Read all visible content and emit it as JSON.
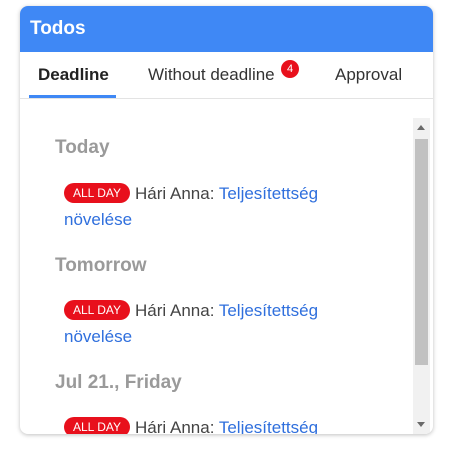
{
  "header": {
    "title": "Todos"
  },
  "tabs": [
    {
      "label": "Deadline",
      "active": true
    },
    {
      "label": "Without deadline",
      "badge": "4"
    },
    {
      "label": "Approval"
    }
  ],
  "groups": [
    {
      "heading": "Today",
      "items": [
        {
          "tag": "ALL DAY",
          "person": "Hári Anna:",
          "link": "Teljesítettség növelése"
        }
      ]
    },
    {
      "heading": "Tomorrow",
      "items": [
        {
          "tag": "ALL DAY",
          "person": "Hári Anna:",
          "link": "Teljesítettség növelése"
        }
      ]
    },
    {
      "heading": "Jul 21., Friday",
      "items": [
        {
          "tag": "ALL DAY",
          "person": "Hári Anna:",
          "link": "Teljesítettség"
        }
      ]
    }
  ],
  "colors": {
    "header": "#3f88f5",
    "badge": "#e8101c",
    "link": "#2f6fdd",
    "heading": "#9a9a9a"
  }
}
